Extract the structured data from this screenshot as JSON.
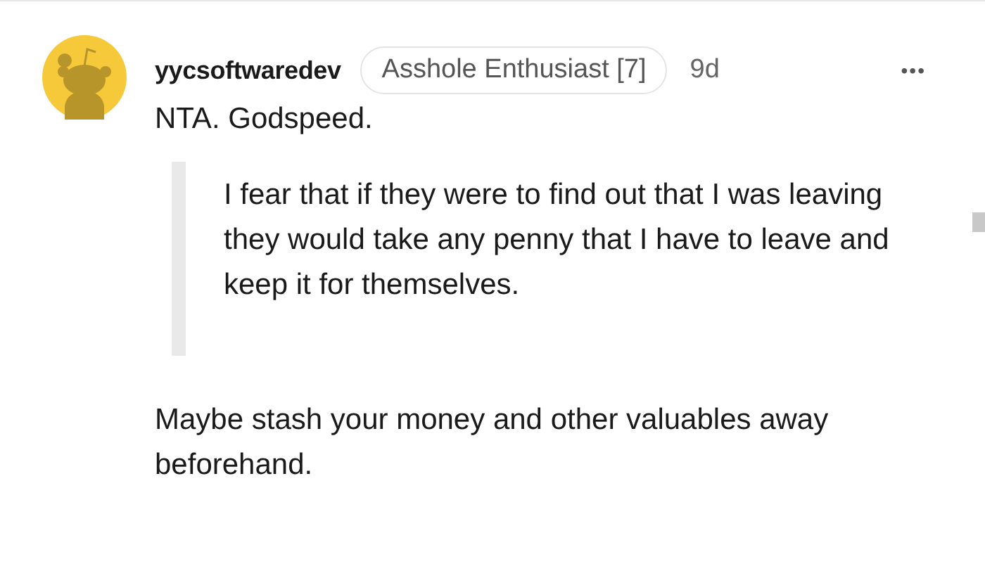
{
  "comment": {
    "author": "yycsoftwaredev",
    "flair": "Asshole Enthusiast [7]",
    "age": "9d",
    "menu": "•••",
    "paragraphs": [
      {
        "kind": "text",
        "text": "NTA. Godspeed."
      },
      {
        "kind": "quote",
        "text": "I fear that if they were to find out that I was leaving they would take any penny that I have to leave and keep it for themselves."
      },
      {
        "kind": "text",
        "text": "Maybe stash your money and other valuables away beforehand."
      }
    ]
  }
}
